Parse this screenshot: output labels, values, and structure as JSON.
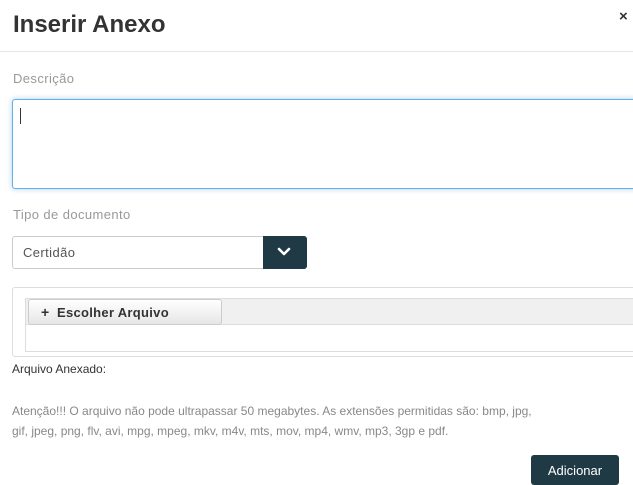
{
  "modal": {
    "title": "Inserir Anexo",
    "close_icon": "close-icon",
    "close_glyph": "×"
  },
  "form": {
    "description_label": "Descrição",
    "description_value": "",
    "doc_type_label": "Tipo de documento",
    "doc_type_selected": "Certidão",
    "dropdown_icon": "chevron-down-icon",
    "choose_file_icon": "plus-icon",
    "choose_file_label": "Escolher Arquivo",
    "attached_label": "Arquivo Anexado:",
    "notice_line1": "Atenção!!! O arquivo não pode ultrapassar 50 megabytes. As extensões permitidas são: bmp, jpg,",
    "notice_line2": "gif, jpeg, png, flv, avi, mpg, mpeg, mkv, m4v, mts, mov, mp4, wmv, mp3, 3gp e pdf.",
    "submit_label": "Adicionar"
  },
  "colors": {
    "primary": "#1f3a45",
    "focus_border": "#66afe9",
    "label_text": "#999999"
  }
}
